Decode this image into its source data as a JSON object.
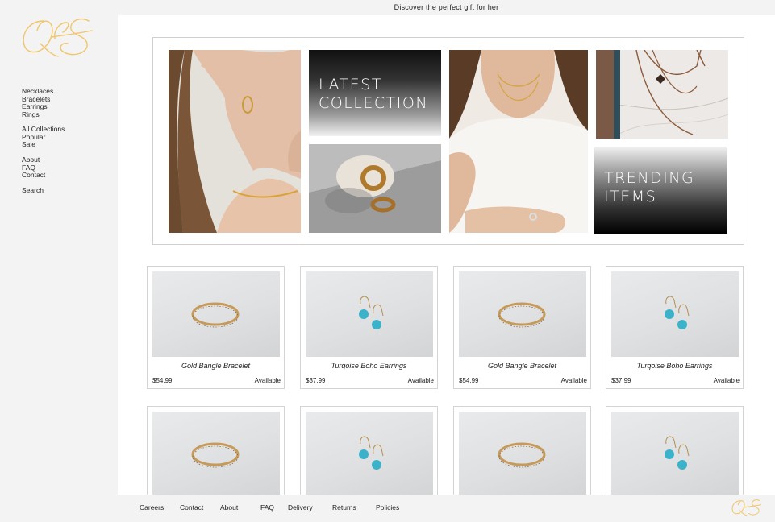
{
  "announcement": "Discover the perfect gift for her",
  "logo": {
    "text": "QS",
    "color": "#f0c66a"
  },
  "sidebar": {
    "categories": [
      "Necklaces",
      "Bracelets",
      "Earrings",
      "Rings"
    ],
    "collections": [
      "All Collections",
      "Popular",
      "Sale"
    ],
    "info": [
      "About",
      "FAQ",
      "Contact"
    ],
    "search": "Search"
  },
  "hero": {
    "latest_label": "LATEST\nCOLLECTION",
    "trending_label": "TRENDING\nITEMS"
  },
  "products_row1": [
    {
      "name": "Gold Bangle Bracelet",
      "price": "$54.99",
      "status": "Available"
    },
    {
      "name": "Turqoise Boho Earrings",
      "price": "$37.99",
      "status": "Available"
    },
    {
      "name": "Gold Bangle Bracelet",
      "price": "$54.99",
      "status": "Available"
    },
    {
      "name": "Turqoise Boho Earrings",
      "price": "$37.99",
      "status": "Available"
    }
  ],
  "footer": {
    "links": [
      "Careers",
      "Contact",
      "About",
      "FAQ",
      "Delivery",
      "Returns",
      "Policies"
    ]
  }
}
